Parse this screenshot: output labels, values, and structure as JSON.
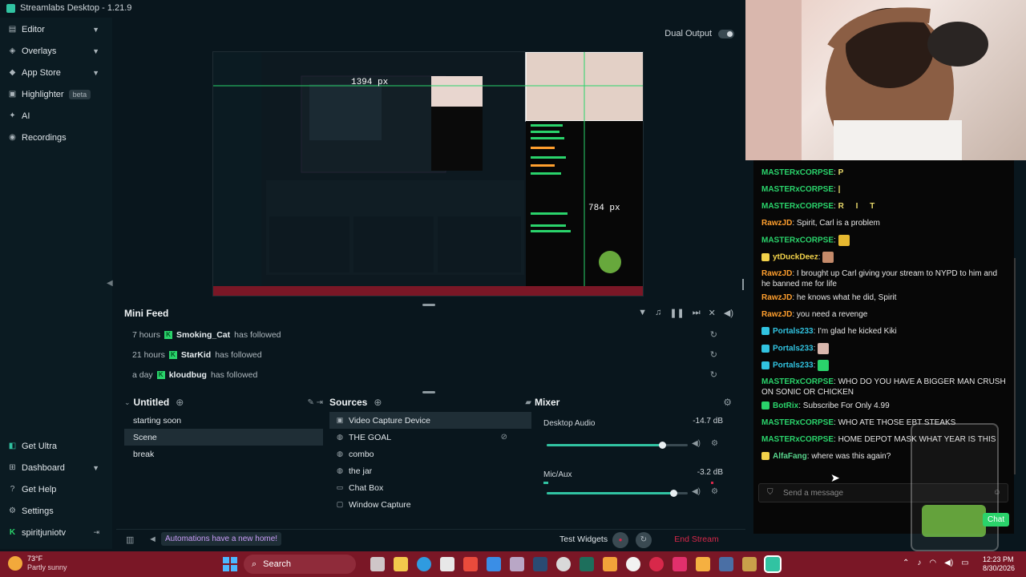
{
  "app": {
    "title": "Streamlabs Desktop - 1.21.9"
  },
  "sidebar": {
    "items": [
      {
        "label": "Editor",
        "icon": "editor-icon",
        "chevron": true
      },
      {
        "label": "Overlays",
        "icon": "overlays-icon",
        "chevron": true
      },
      {
        "label": "App Store",
        "icon": "app-store-icon",
        "chevron": true
      },
      {
        "label": "Highlighter",
        "icon": "highlighter-icon",
        "badge": "beta"
      },
      {
        "label": "AI",
        "icon": "ai-icon"
      },
      {
        "label": "Recordings",
        "icon": "recordings-icon"
      }
    ],
    "bottom": [
      {
        "label": "Get Ultra",
        "icon": "ultra-icon"
      },
      {
        "label": "Dashboard",
        "icon": "dashboard-icon",
        "chevron": true
      },
      {
        "label": "Get Help",
        "icon": "help-icon"
      },
      {
        "label": "Settings",
        "icon": "gear-icon"
      }
    ],
    "user": {
      "name": "spiritjuniotv"
    }
  },
  "header": {
    "dual_output": "Dual Output"
  },
  "preview": {
    "measure_w": "1394 px",
    "measure_h": "784 px"
  },
  "mini_feed": {
    "title": "Mini Feed",
    "items": [
      {
        "time": "7 hours",
        "name": "Smoking_Cat",
        "action": "has followed"
      },
      {
        "time": "21 hours",
        "name": "StarKid",
        "action": "has followed"
      },
      {
        "time": "a day",
        "name": "kloudbug",
        "action": "has followed"
      }
    ]
  },
  "scenes": {
    "title": "Untitled",
    "items": [
      "starting soon",
      "Scene",
      "break"
    ],
    "selected": "Scene"
  },
  "sources": {
    "title": "Sources",
    "items": [
      "Video Capture Device",
      "THE GOAL",
      "combo",
      "the jar",
      "Chat Box",
      "Window Capture"
    ]
  },
  "mixer": {
    "title": "Mixer",
    "channels": [
      {
        "name": "Desktop Audio",
        "db": "-14.7 dB",
        "level": 0.82
      },
      {
        "name": "Mic/Aux",
        "db": "-3.2 dB",
        "level": 0.9
      }
    ]
  },
  "footer": {
    "automations": "Automations have a new home!",
    "test_widgets": "Test Widgets",
    "end_stream": "End Stream"
  },
  "chat": {
    "messages": [
      {
        "user": "MASTERxCORPSE",
        "text": "",
        "emote": "P",
        "color": "master"
      },
      {
        "user": "MASTERxCORPSE",
        "text": "",
        "emote": "|",
        "color": "master"
      },
      {
        "user": "MASTERxCORPSE",
        "text": "",
        "emote": "R I T",
        "color": "master"
      },
      {
        "user": "RawzJD",
        "text": "Spirit, Carl is a problem",
        "color": "rawz"
      },
      {
        "user": "MASTERxCORPSE",
        "text": "",
        "emote": "emote",
        "color": "master"
      },
      {
        "user": "ytDuckDeez",
        "text": "",
        "emote": "emote",
        "color": "duck"
      },
      {
        "user": "RawzJD",
        "text": "I brought up Carl giving your stream to NYPD to him and he banned me for life",
        "color": "rawz"
      },
      {
        "user": "RawzJD",
        "text": "he knows what he did, Spirit",
        "color": "rawz"
      },
      {
        "user": "RawzJD",
        "text": "you need a revenge",
        "color": "rawz"
      },
      {
        "user": "Portals233",
        "text": "I'm glad he kicked Kiki",
        "color": "portal"
      },
      {
        "user": "Portals233",
        "text": "",
        "emote": "emote",
        "color": "portal"
      },
      {
        "user": "Portals233",
        "text": "",
        "emote": "emote",
        "color": "portal"
      },
      {
        "user": "MASTERxCORPSE",
        "text": "WHO DO YOU HAVE A BIGGER MAN CRUSH ON SONIC OR CHICKEN",
        "color": "master"
      },
      {
        "user": "BotRix",
        "text": "Subscribe For Only 4.99",
        "color": "botrix"
      },
      {
        "user": "MASTERxCORPSE",
        "text": "WHO ATE THOSE EBT STEAKS",
        "color": "master"
      },
      {
        "user": "MASTERxCORPSE",
        "text": "HOME DEPOT MASK WHAT YEAR IS THIS",
        "color": "master"
      },
      {
        "user": "AlfaFang",
        "text": "where was this again?",
        "color": "alfa"
      }
    ],
    "input_placeholder": "Send a message",
    "chat_button": "Chat"
  },
  "taskbar": {
    "weather_temp": "73°F",
    "weather_desc": "Partly sunny",
    "search_placeholder": "Search",
    "time": "12:23 PM",
    "date": "8/30/2026"
  },
  "colors": {
    "accent": "#31c3a2",
    "kick": "#2ad36b",
    "end_stream": "#d8284a",
    "taskbar": "#7a1726"
  }
}
